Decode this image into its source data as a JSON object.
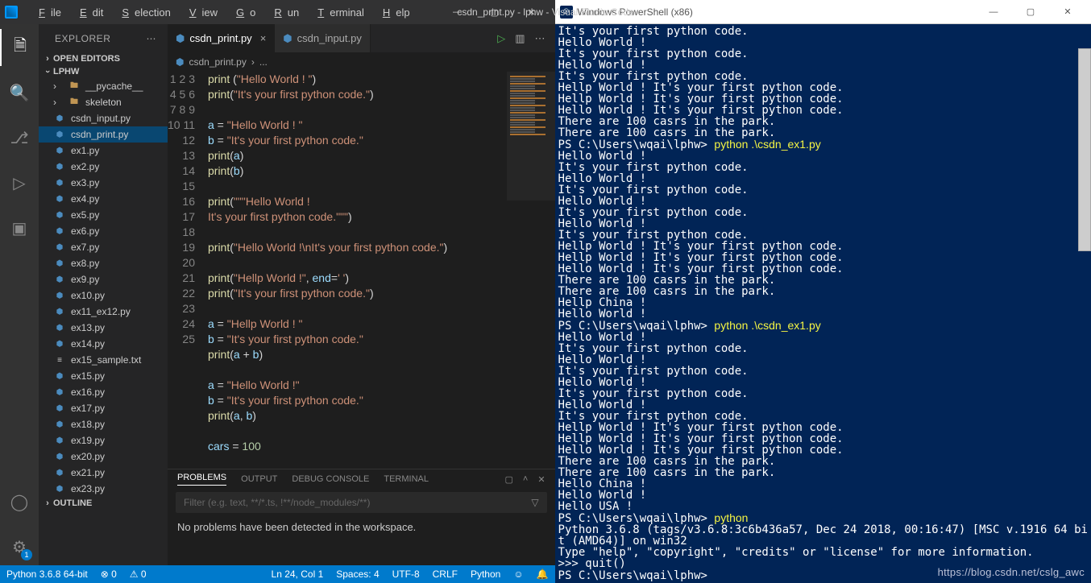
{
  "titlebar": {
    "menus": [
      "File",
      "Edit",
      "Selection",
      "View",
      "Go",
      "Run",
      "Terminal",
      "Help"
    ],
    "title": "csdn_print.py - lphw - Visual Studio Code"
  },
  "activity": {
    "icons": [
      "files",
      "search",
      "scm",
      "debug",
      "extensions"
    ],
    "bottom": [
      "account",
      "settings"
    ],
    "badge": "1"
  },
  "sidebar": {
    "title": "EXPLORER",
    "sections": {
      "open_editors": "OPEN EDITORS",
      "workspace": "LPHW",
      "outline": "OUTLINE"
    },
    "folders": [
      "__pycache__",
      "skeleton"
    ],
    "files": [
      "csdn_input.py",
      "csdn_print.py",
      "ex1.py",
      "ex2.py",
      "ex3.py",
      "ex4.py",
      "ex5.py",
      "ex6.py",
      "ex7.py",
      "ex8.py",
      "ex9.py",
      "ex10.py",
      "ex11_ex12.py",
      "ex13.py",
      "ex14.py",
      "ex15_sample.txt",
      "ex15.py",
      "ex16.py",
      "ex17.py",
      "ex18.py",
      "ex19.py",
      "ex20.py",
      "ex21.py",
      "ex23.py"
    ],
    "selected": "csdn_print.py"
  },
  "tabs": {
    "items": [
      {
        "label": "csdn_print.py",
        "active": true
      },
      {
        "label": "csdn_input.py",
        "active": false
      }
    ]
  },
  "breadcrumbs": {
    "file": "csdn_print.py",
    "tail": "..."
  },
  "code_lines": [
    [
      [
        "fn",
        "print"
      ],
      [
        "op",
        " ("
      ],
      [
        "str",
        "\"Hello World ! \""
      ],
      [
        "op",
        ")"
      ]
    ],
    [
      [
        "fn",
        "print"
      ],
      [
        "op",
        "("
      ],
      [
        "str",
        "\"It's your first python code.\""
      ],
      [
        "op",
        ")"
      ]
    ],
    [],
    [
      [
        "var",
        "a"
      ],
      [
        "op",
        " = "
      ],
      [
        "str",
        "\"Hello World ! \""
      ]
    ],
    [
      [
        "var",
        "b"
      ],
      [
        "op",
        " = "
      ],
      [
        "str",
        "\"It's your first python code.\""
      ]
    ],
    [
      [
        "fn",
        "print"
      ],
      [
        "op",
        "("
      ],
      [
        "var",
        "a"
      ],
      [
        "op",
        ")"
      ]
    ],
    [
      [
        "fn",
        "print"
      ],
      [
        "op",
        "("
      ],
      [
        "var",
        "b"
      ],
      [
        "op",
        ")"
      ]
    ],
    [],
    [
      [
        "fn",
        "print"
      ],
      [
        "op",
        "("
      ],
      [
        "str",
        "\"\"\"Hello World !"
      ]
    ],
    [
      [
        "str",
        "It's your first python code.\"\"\""
      ],
      [
        "op",
        ")"
      ]
    ],
    [],
    [
      [
        "fn",
        "print"
      ],
      [
        "op",
        "("
      ],
      [
        "str",
        "\"Hello World !\\nIt's your first python code.\""
      ],
      [
        "op",
        ")"
      ]
    ],
    [],
    [
      [
        "fn",
        "print"
      ],
      [
        "op",
        "("
      ],
      [
        "str",
        "\"Hellp World !\""
      ],
      [
        "op",
        ", "
      ],
      [
        "var",
        "end"
      ],
      [
        "op",
        "="
      ],
      [
        "str",
        "' '"
      ],
      [
        "op",
        ")"
      ]
    ],
    [
      [
        "fn",
        "print"
      ],
      [
        "op",
        "("
      ],
      [
        "str",
        "\"It's your first python code.\""
      ],
      [
        "op",
        ")"
      ]
    ],
    [],
    [
      [
        "var",
        "a"
      ],
      [
        "op",
        " = "
      ],
      [
        "str",
        "\"Hellp World ! \""
      ]
    ],
    [
      [
        "var",
        "b"
      ],
      [
        "op",
        " = "
      ],
      [
        "str",
        "\"It's your first python code.\""
      ]
    ],
    [
      [
        "fn",
        "print"
      ],
      [
        "op",
        "("
      ],
      [
        "var",
        "a"
      ],
      [
        "op",
        " + "
      ],
      [
        "var",
        "b"
      ],
      [
        "op",
        ")"
      ]
    ],
    [],
    [
      [
        "var",
        "a"
      ],
      [
        "op",
        " = "
      ],
      [
        "str",
        "\"Hello World !\""
      ]
    ],
    [
      [
        "var",
        "b"
      ],
      [
        "op",
        " = "
      ],
      [
        "str",
        "\"It's your first python code.\""
      ]
    ],
    [
      [
        "fn",
        "print"
      ],
      [
        "op",
        "("
      ],
      [
        "var",
        "a"
      ],
      [
        "op",
        ", "
      ],
      [
        "var",
        "b"
      ],
      [
        "op",
        ")"
      ]
    ],
    [],
    [
      [
        "var",
        "cars"
      ],
      [
        "op",
        " = "
      ],
      [
        "num",
        "100"
      ]
    ]
  ],
  "panel": {
    "tabs": [
      "PROBLEMS",
      "OUTPUT",
      "DEBUG CONSOLE",
      "TERMINAL"
    ],
    "active": "PROBLEMS",
    "filter_placeholder": "Filter (e.g. text, **/*.ts, !**/node_modules/**)",
    "message": "No problems have been detected in the workspace."
  },
  "status": {
    "left": [
      "Python 3.6.8 64-bit",
      "⊗ 0",
      "⚠ 0"
    ],
    "right": [
      "Ln 24, Col 1",
      "Spaces: 4",
      "UTF-8",
      "CRLF",
      "Python",
      "☺",
      "🔔"
    ]
  },
  "powershell": {
    "title": "Windows PowerShell (x86)",
    "lines": [
      "It's your first python code.",
      "Hello World !",
      "It's your first python code.",
      "Hello World !",
      "It's your first python code.",
      "Hellp World ! It's your first python code.",
      "Hellp World ! It's your first python code.",
      "Hello World ! It's your first python code.",
      "There are 100 casrs in the park.",
      "There are 100 casrs in the park.",
      {
        "prompt": "PS C:\\Users\\wqai\\lphw> ",
        "cmd": "python .\\csdn_ex1.py"
      },
      "Hello World !",
      "It's your first python code.",
      "Hello World !",
      "It's your first python code.",
      "Hello World !",
      "It's your first python code.",
      "Hello World !",
      "It's your first python code.",
      "Hellp World ! It's your first python code.",
      "Hellp World ! It's your first python code.",
      "Hello World ! It's your first python code.",
      "There are 100 casrs in the park.",
      "There are 100 casrs in the park.",
      "Hellp China !",
      "Hello World !",
      {
        "prompt": "PS C:\\Users\\wqai\\lphw> ",
        "cmd": "python .\\csdn_ex1.py"
      },
      "Hello World !",
      "It's your first python code.",
      "Hello World !",
      "It's your first python code.",
      "Hello World !",
      "It's your first python code.",
      "Hello World !",
      "It's your first python code.",
      "Hellp World ! It's your first python code.",
      "Hellp World ! It's your first python code.",
      "Hello World ! It's your first python code.",
      "There are 100 casrs in the park.",
      "There are 100 casrs in the park.",
      "Hello China !",
      "Hello World !",
      "Hello USA !",
      {
        "prompt": "PS C:\\Users\\wqai\\lphw> ",
        "cmd": "python"
      },
      "Python 3.6.8 (tags/v3.6.8:3c6b436a57, Dec 24 2018, 00:16:47) [MSC v.1916 64 bi",
      "t (AMD64)] on win32",
      "Type \"help\", \"copyright\", \"credits\" or \"license\" for more information.",
      ">>> quit()",
      {
        "prompt": "PS C:\\Users\\wqai\\lphw> ",
        "cmd": ""
      }
    ]
  },
  "watermark": "https://blog.csdn.net/cslg_awc"
}
